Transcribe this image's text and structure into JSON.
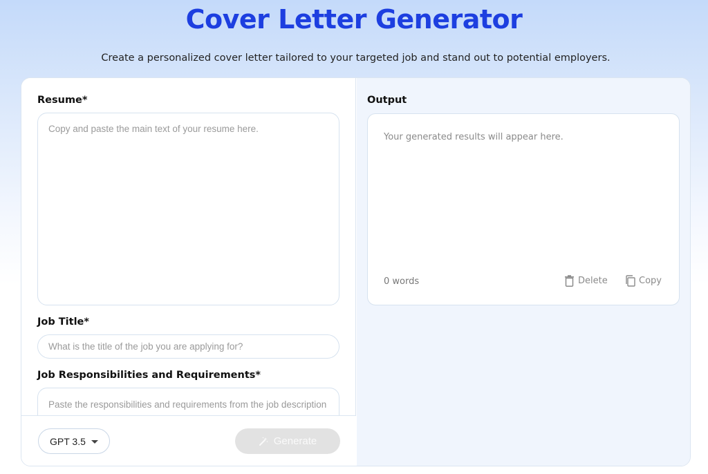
{
  "header": {
    "title": "Cover Letter Generator",
    "subtitle": "Create a personalized cover letter tailored to your targeted job and stand out to potential employers."
  },
  "form": {
    "resume": {
      "label": "Resume*",
      "placeholder": "Copy and paste the main text of your resume here."
    },
    "job_title": {
      "label": "Job Title*",
      "placeholder": "What is the title of the job you are applying for?"
    },
    "responsibilities": {
      "label": "Job Responsibilities and Requirements*",
      "placeholder": "Paste the responsibilities and requirements from the job description"
    },
    "model_select": {
      "value": "GPT 3.5"
    },
    "generate_label": "Generate"
  },
  "output": {
    "label": "Output",
    "placeholder": "Your generated results will appear here.",
    "word_count": "0 words",
    "delete_label": "Delete",
    "copy_label": "Copy"
  },
  "icons": {
    "model_dropdown": "caret-down-icon",
    "generate": "magic-wand-icon",
    "delete": "trash-icon",
    "copy": "copy-icon"
  },
  "colors": {
    "title": "#1d3fe0",
    "generate_disabled_bg": "#e2e2e2",
    "panel_right_bg": "#f0f5fd"
  }
}
